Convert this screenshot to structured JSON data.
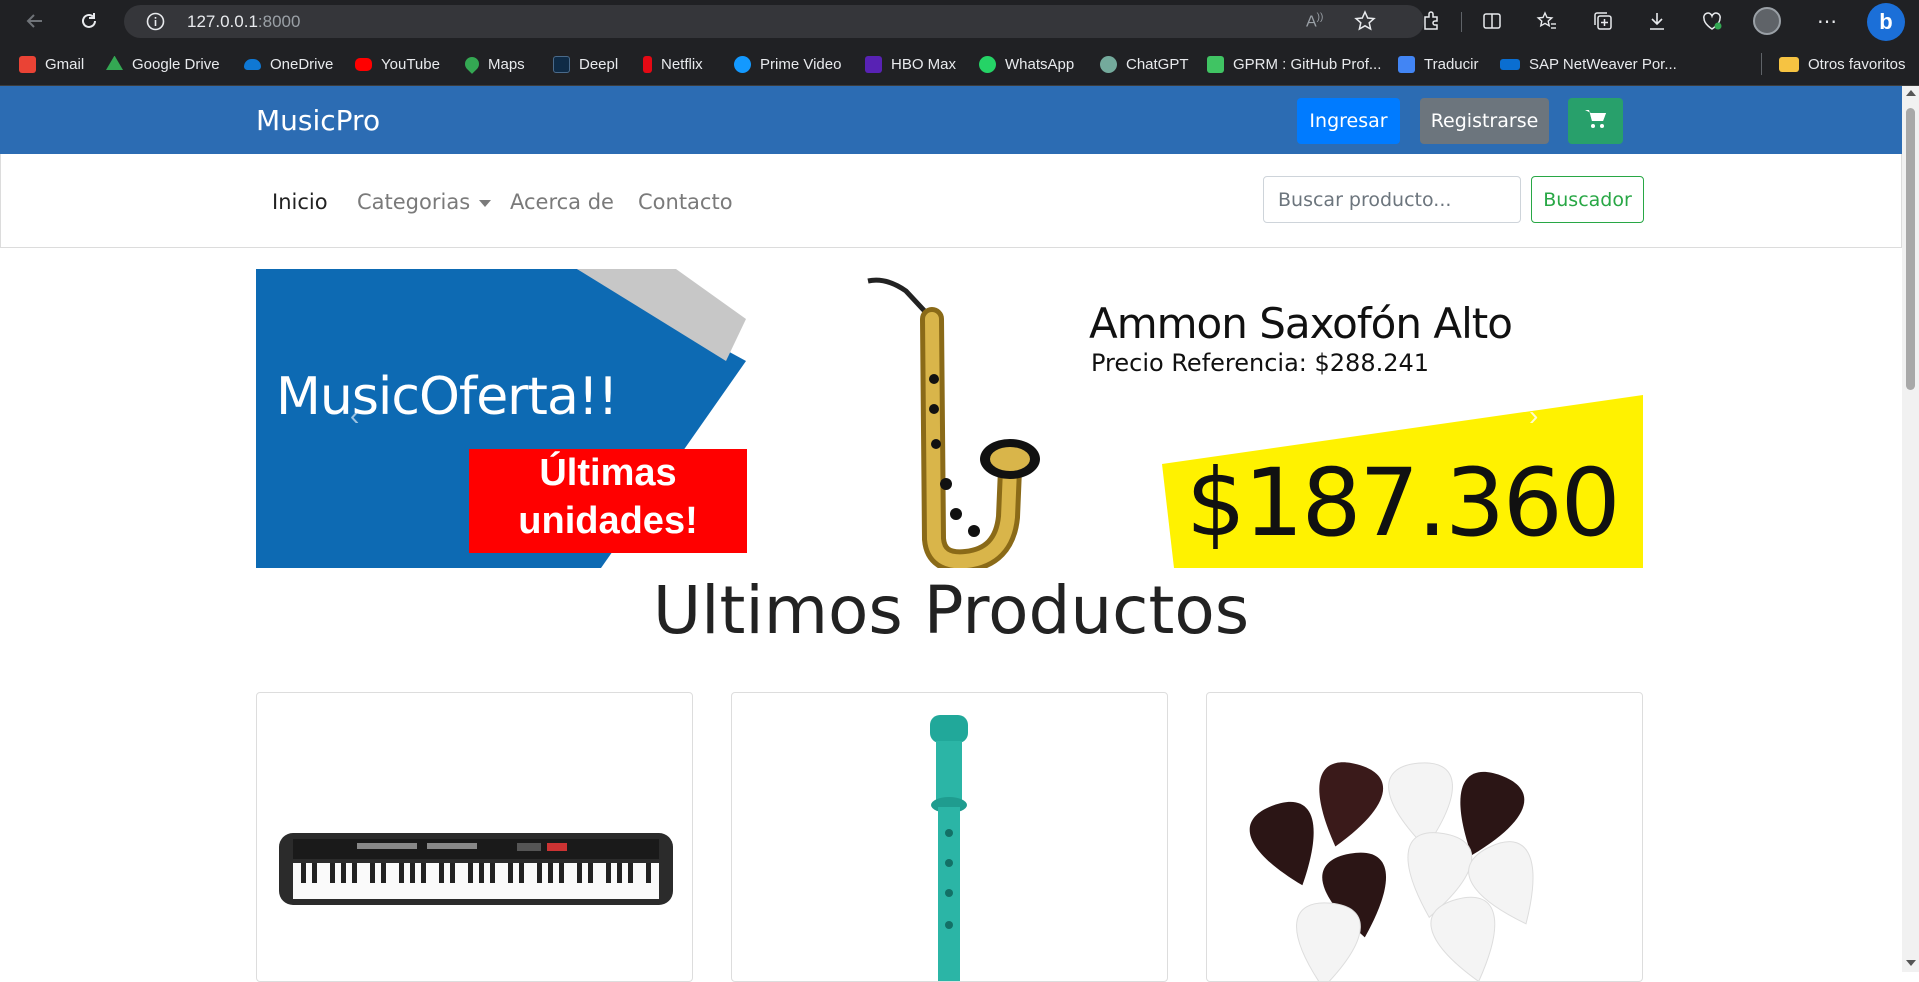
{
  "browser": {
    "address_host": "127.0.0.1",
    "address_port": ":8000",
    "bookmarks": [
      {
        "label": "Gmail",
        "color": "#ea4335"
      },
      {
        "label": "Google Drive",
        "color": "#34a853"
      },
      {
        "label": "OneDrive",
        "color": "#0f78d4"
      },
      {
        "label": "YouTube",
        "color": "#ff0000"
      },
      {
        "label": "Maps",
        "color": "#34a853"
      },
      {
        "label": "Deepl",
        "color": "#0f2b46"
      },
      {
        "label": "Netflix",
        "color": "#e50914"
      },
      {
        "label": "Prime Video",
        "color": "#1399ff"
      },
      {
        "label": "HBO Max",
        "color": "#5822b4"
      },
      {
        "label": "WhatsApp",
        "color": "#25d366"
      },
      {
        "label": "ChatGPT",
        "color": "#74aa9c"
      },
      {
        "label": "GPRM : GitHub Prof...",
        "color": "#40c463"
      },
      {
        "label": "Traducir",
        "color": "#4285f4"
      },
      {
        "label": "SAP NetWeaver Por...",
        "color": "#0a6ed1"
      }
    ],
    "other_favorites": "Otros favoritos"
  },
  "header": {
    "brand": "MusicPro",
    "login": "Ingresar",
    "register": "Registrarse",
    "brand_color": "#2c6cb3"
  },
  "nav": {
    "home": "Inicio",
    "categories": "Categorias",
    "about": "Acerca de",
    "contact": "Contacto",
    "search_placeholder": "Buscar producto...",
    "search_button": "Buscador"
  },
  "banner": {
    "offer": "MusicOferta!!",
    "last_units_line1": "Últimas",
    "last_units_line2": "unidades!",
    "product_name": "Ammon Saxofón Alto",
    "reference_price": "Precio Referencia: $288.241",
    "price": "$187.360"
  },
  "products": {
    "title": "Ultimos Productos",
    "items": [
      {
        "image": "keyboard"
      },
      {
        "image": "recorder-flute"
      },
      {
        "image": "guitar-picks"
      }
    ]
  }
}
